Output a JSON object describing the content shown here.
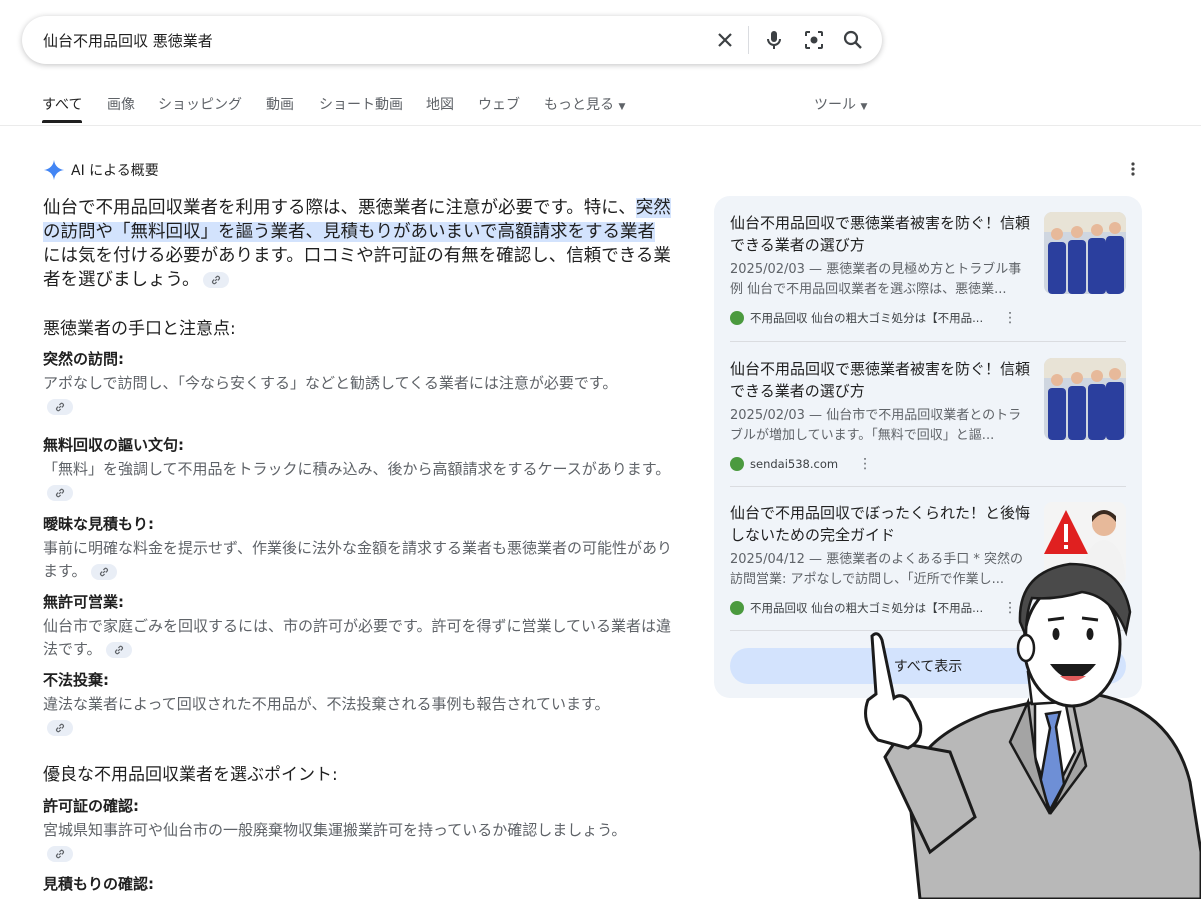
{
  "search": {
    "query": "仙台不用品回収 悪徳業者"
  },
  "search_icons": [
    "clear-icon",
    "microphone-icon",
    "lens-icon",
    "search-icon"
  ],
  "tabs": [
    "すべて",
    "画像",
    "ショッピング",
    "動画",
    "ショート動画",
    "地図",
    "ウェブ",
    "もっと見る",
    "ツール"
  ],
  "overview": {
    "label": "AI による概要",
    "summary_a": "仙台で不用品回収業者を利用する際は、悪徳業者に注意が必要です。特に、",
    "summary_hl": "突然の訪問や「無料回収」を謳う業者、見積もりがあいまいで高額請求をする業者",
    "summary_b": "には気を付ける必要があります。口コミや許可証の有無を確認し、信頼できる業者を選びましょう。",
    "section1": "悪徳業者の手口と注意点:",
    "items": [
      {
        "title": "突然の訪問:",
        "text": "アポなしで訪問し、「今なら安くする」などと勧誘してくる業者には注意が必要です。"
      },
      {
        "title": "無料回収の謳い文句:",
        "text": "「無料」を強調して不用品をトラックに積み込み、後から高額請求をするケースがあります。"
      },
      {
        "title": "曖昧な見積もり:",
        "text": "事前に明確な料金を提示せず、作業後に法外な金額を請求する業者も悪徳業者の可能性があります。"
      },
      {
        "title": "無許可営業:",
        "text": "仙台市で家庭ごみを回収するには、市の許可が必要です。許可を得ずに営業している業者は違法です。"
      },
      {
        "title": "不法投棄:",
        "text": "違法な業者によって回収された不用品が、不法投棄される事例も報告されています。"
      }
    ],
    "section2": "優良な不用品回収業者を選ぶポイント:",
    "items2": [
      {
        "title": "許可証の確認:",
        "text": "宮城県知事許可や仙台市の一般廃棄物収集運搬業許可を持っているか確認しましょう。"
      },
      {
        "title": "見積もりの確認:",
        "text": ""
      }
    ]
  },
  "sources": [
    {
      "title": "仙台不用品回収で悪徳業者被害を防ぐ！信頼できる業者の選び方",
      "desc": "2025/02/03 — 悪徳業者の見極め方とトラブル事例 仙台で不用品回収業者を選ぶ際は、悪徳業...",
      "site": "不用品回収 仙台の粗大ゴミ処分は【不用品..."
    },
    {
      "title": "仙台不用品回収で悪徳業者被害を防ぐ！信頼できる業者の選び方",
      "desc": "2025/02/03 — 仙台市で不用品回収業者とのトラブルが増加しています。「無料で回収」と謳...",
      "site": "sendai538.com"
    },
    {
      "title": "仙台で不用品回収でぼったくられた！と後悔しないための完全ガイド",
      "desc": "2025/04/12 — 悪徳業者のよくある手口 * 突然の訪問営業: アポなしで訪問し、「近所で作業し...",
      "site": "不用品回収 仙台の粗大ゴミ処分は【不用品..."
    }
  ],
  "show_all": "すべて表示",
  "colors": {
    "highlight": "#d3e3fd",
    "panel": "#f0f4f9",
    "gemini": "#4285f4"
  }
}
